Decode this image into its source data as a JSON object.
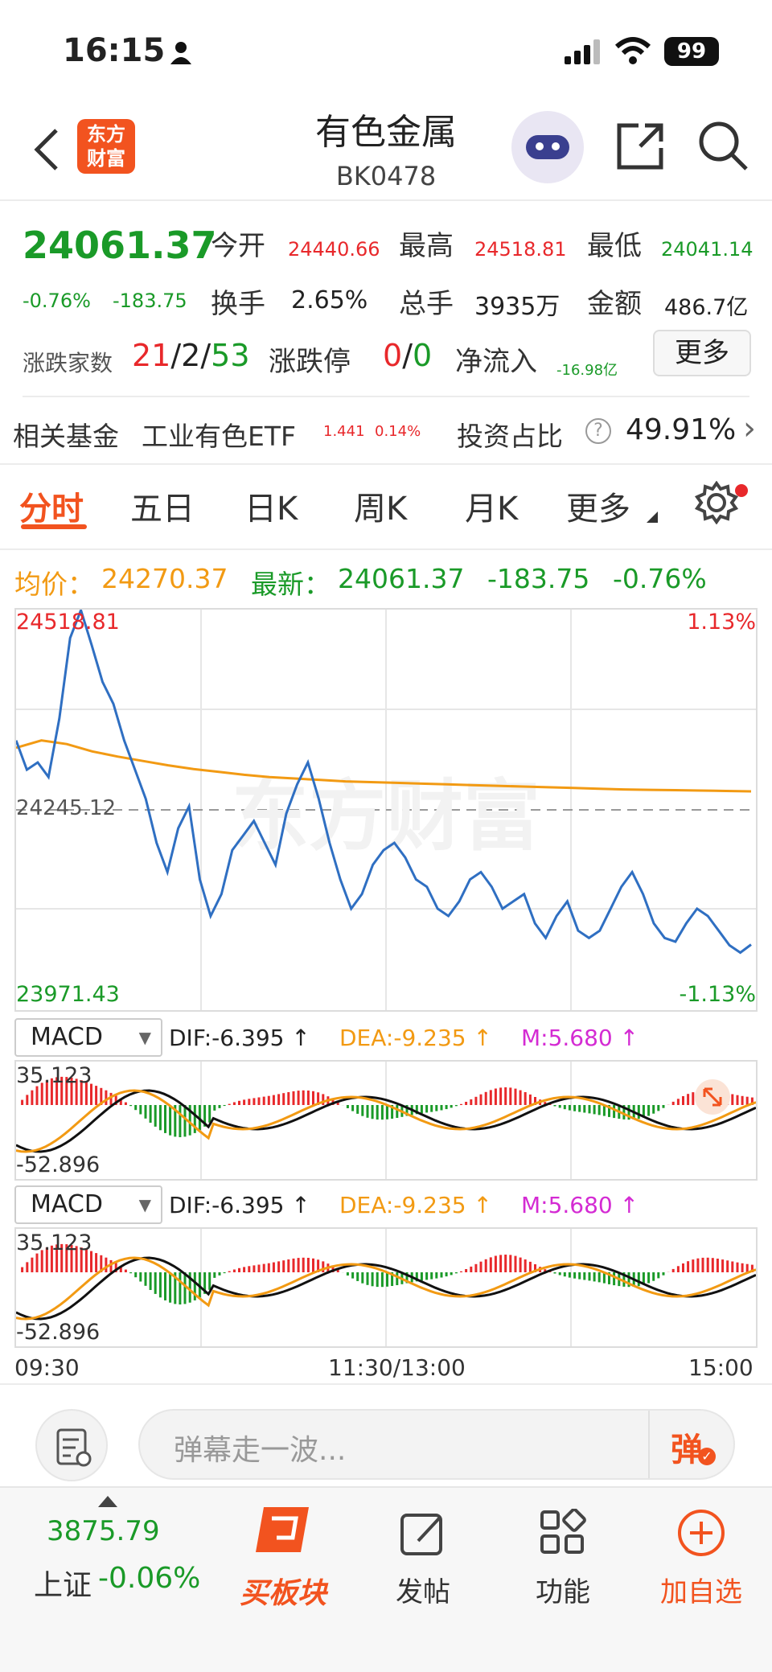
{
  "status_bar": {
    "time": "16:15",
    "battery": "99"
  },
  "header": {
    "title": "有色金属",
    "code": "BK0478",
    "logo_text": "东方\n财富"
  },
  "quote": {
    "price": "24061.37",
    "change_pct": "-0.76%",
    "change_amt": "-183.75",
    "open_label": "今开",
    "open": "24440.66",
    "high_label": "最高",
    "high": "24518.81",
    "low_label": "最低",
    "low": "24041.14",
    "turnover_label": "换手",
    "turnover": "2.65%",
    "volume_label": "总手",
    "volume": "3935万",
    "amount_label": "金额",
    "amount": "486.7亿",
    "breadth_label": "涨跌家数",
    "up": "21",
    "flat": "2",
    "down": "53",
    "limit_label": "涨跌停",
    "limit_up": "0",
    "limit_down": "0",
    "netflow_label": "净流入",
    "netflow": "-16.98亿",
    "more_button": "更多"
  },
  "fund": {
    "label": "相关基金",
    "name": "工业有色ETF",
    "price": "1.441",
    "pct": "0.14%",
    "ratio_label": "投资占比",
    "ratio": "49.91%"
  },
  "tabs": [
    {
      "label": "分时",
      "active": true
    },
    {
      "label": "五日"
    },
    {
      "label": "日K"
    },
    {
      "label": "周K"
    },
    {
      "label": "月K"
    },
    {
      "label": "更多"
    }
  ],
  "summary": {
    "avg_label": "均价：",
    "avg": "24270.37",
    "latest_label": "最新：",
    "latest": "24061.37",
    "chg": "-183.75",
    "pct": "-0.76%"
  },
  "chart_labels": {
    "y_max": "24518.81",
    "y_mid": "24245.12",
    "y_min": "23971.43",
    "pct_max": "1.13%",
    "pct_min": "-1.13%",
    "watermark": "东方财富"
  },
  "chart_data": {
    "type": "line",
    "ylim": [
      23971.43,
      24518.81
    ],
    "reference": 24245.12,
    "x": [
      "09:30",
      "11:30/13:00",
      "15:00"
    ],
    "series": [
      {
        "values": [
          24340,
          24300,
          24310,
          24290,
          24370,
          24480,
          24518,
          24470,
          24420,
          24390,
          24340,
          24300,
          24260,
          24200,
          24160,
          24220,
          24250,
          24150,
          24100,
          24130,
          24190,
          24210,
          24230,
          24200,
          24170,
          24240,
          24280,
          24310,
          24260,
          24200,
          24150,
          24110,
          24130,
          24170,
          24190,
          24200,
          24180,
          24150,
          24140,
          24110,
          24100,
          24120,
          24150,
          24160,
          24140,
          24110,
          24120,
          24130,
          24090,
          24070,
          24100,
          24120,
          24080,
          24070,
          24080,
          24110,
          24140,
          24160,
          24130,
          24090,
          24070,
          24065,
          24090,
          24110,
          24100,
          24080,
          24060,
          24050,
          24061
        ]
      },
      {
        "values": [
          24330,
          24340,
          24335,
          24325,
          24318,
          24312,
          24306,
          24301,
          24297,
          24293,
          24290,
          24288,
          24286,
          24284,
          24283,
          24282,
          24281,
          24280,
          24279,
          24278,
          24277,
          24276,
          24275,
          24274,
          24273,
          24272.5,
          24272,
          24271.5,
          24271,
          24270.37
        ]
      }
    ]
  },
  "macd": {
    "selector": "MACD",
    "dif": "DIF:-6.395 ↑",
    "dea": "DEA:-9.235 ↑",
    "m": "M:5.680 ↑",
    "max": "35.123",
    "min": "-52.896"
  },
  "time_axis": {
    "start": "09:30",
    "mid": "11:30/13:00",
    "end": "15:00"
  },
  "comment": {
    "placeholder": "弹幕走一波...",
    "danmaku_button": "弹"
  },
  "bottom_nav": {
    "index_value": "3875.79",
    "index_name": "上证",
    "index_pct": "-0.06%",
    "buy_block": "买板块",
    "post": "发帖",
    "functions": "功能",
    "add_watch": "加自选"
  }
}
